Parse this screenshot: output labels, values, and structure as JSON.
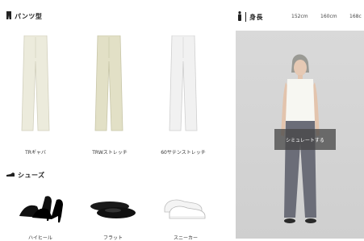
{
  "pants_section": {
    "title": "パンツ型",
    "items": [
      {
        "label": "TRギャバ",
        "color": "#ecebdc"
      },
      {
        "label": "TRWストレッチ",
        "color": "#e2e0c6"
      },
      {
        "label": "60サテンストレッチ",
        "color": "#f0f0f0"
      }
    ]
  },
  "shoes_section": {
    "title": "シューズ",
    "items": [
      {
        "label": "ハイヒール"
      },
      {
        "label": "フラット"
      },
      {
        "label": "スニーカー"
      }
    ]
  },
  "height": {
    "title": "身長",
    "options": [
      "152cm",
      "160cm",
      "168c"
    ]
  },
  "preview": {
    "simulate_label": "シミュレートする"
  }
}
